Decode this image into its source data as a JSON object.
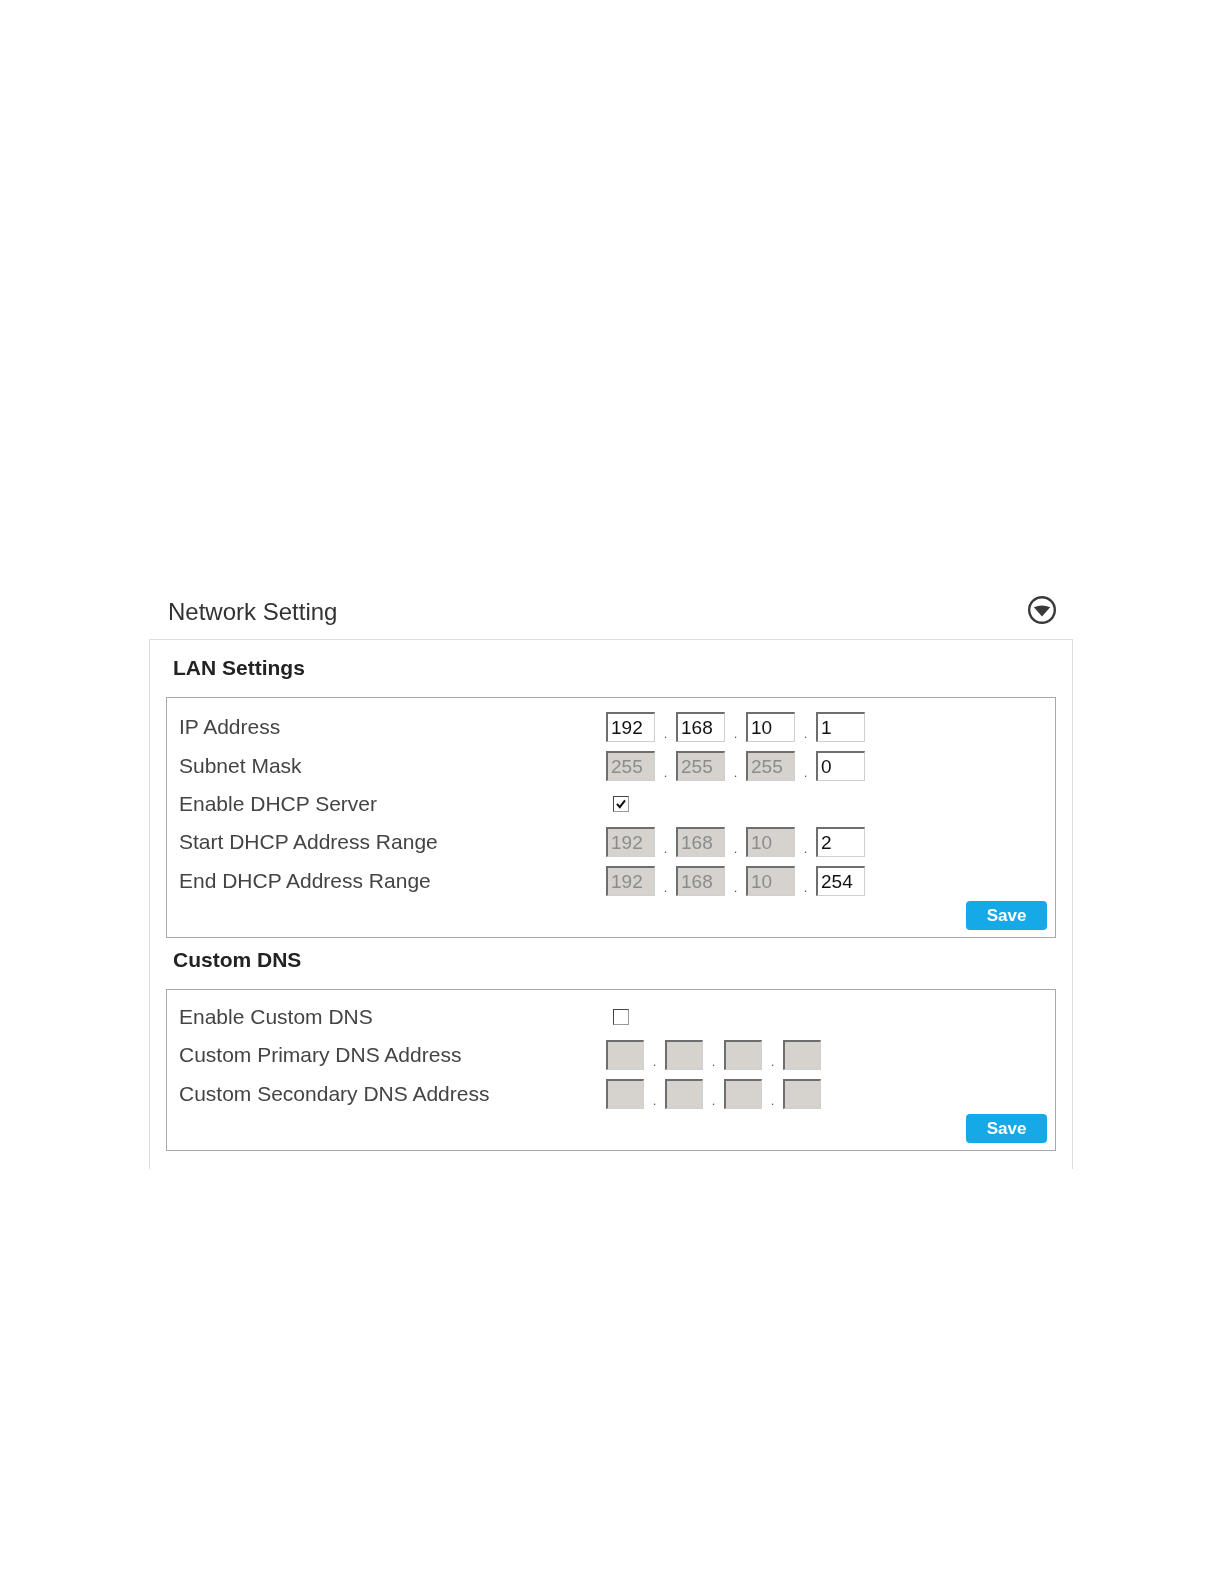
{
  "header": {
    "title": "Network Setting"
  },
  "sections": [
    {
      "title": "LAN Settings",
      "kind": "lan",
      "rows": [
        {
          "label": "IP Address",
          "kind": "address",
          "octets": [
            {
              "value": "192",
              "disabled": false
            },
            {
              "value": "168",
              "disabled": false
            },
            {
              "value": "10",
              "disabled": false
            },
            {
              "value": "1",
              "disabled": false
            }
          ],
          "separators": [
            ".",
            ".",
            "."
          ]
        },
        {
          "label": "Subnet Mask",
          "kind": "address",
          "octets": [
            {
              "value": "255",
              "disabled": true
            },
            {
              "value": "255",
              "disabled": true
            },
            {
              "value": "255",
              "disabled": true
            },
            {
              "value": "0",
              "disabled": false
            }
          ],
          "separators": [
            ".",
            ".",
            "."
          ]
        },
        {
          "label": "Enable DHCP Server",
          "kind": "checkbox",
          "checked": true
        },
        {
          "label": "Start DHCP Address Range",
          "kind": "address",
          "octets": [
            {
              "value": "192",
              "disabled": true
            },
            {
              "value": "168",
              "disabled": true
            },
            {
              "value": "10",
              "disabled": true
            },
            {
              "value": "2",
              "disabled": false
            }
          ],
          "separators": [
            ".",
            ".",
            "."
          ]
        },
        {
          "label": "End DHCP Address Range",
          "kind": "address",
          "octets": [
            {
              "value": "192",
              "disabled": true
            },
            {
              "value": "168",
              "disabled": true
            },
            {
              "value": "10",
              "disabled": true
            },
            {
              "value": "254",
              "disabled": false
            }
          ],
          "separators": [
            ".",
            ".",
            "."
          ]
        }
      ],
      "button": "Save"
    },
    {
      "title": "Custom DNS",
      "kind": "dns",
      "rows": [
        {
          "label": "Enable Custom DNS",
          "kind": "checkbox",
          "checked": false
        },
        {
          "label": "Custom Primary DNS Address",
          "kind": "address",
          "octets": [
            {
              "disabled": true
            },
            {
              "disabled": true
            },
            {
              "disabled": true
            },
            {
              "disabled": true
            }
          ],
          "separators": [
            ".",
            ".",
            "."
          ]
        },
        {
          "label": "Custom Secondary DNS Address",
          "kind": "address",
          "octets": [
            {
              "disabled": true
            },
            {
              "disabled": true
            },
            {
              "disabled": true
            },
            {
              "disabled": true
            }
          ],
          "separators": [
            ".",
            ".",
            "."
          ]
        }
      ],
      "button": "Save"
    }
  ]
}
